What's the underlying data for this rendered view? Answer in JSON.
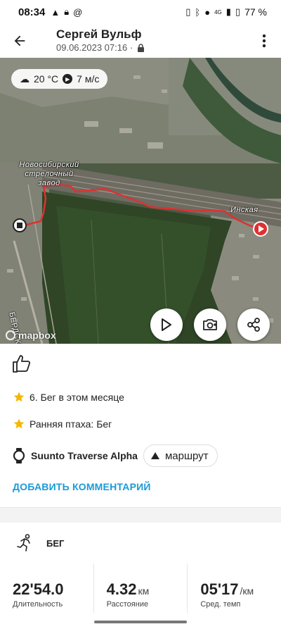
{
  "status_bar": {
    "time": "08:34",
    "battery": "77 %",
    "network": "4G"
  },
  "header": {
    "title": "Сергей Вульф",
    "subtitle": "09.06.2023 07:16 ·"
  },
  "map": {
    "weather": {
      "temp": "20 °C",
      "wind": "7 м/с"
    },
    "label_start": "Новосибирский стрелочный завод",
    "label_end": "Инская",
    "label_road": "БЕРДСКОЕ",
    "attribution": "mapbox"
  },
  "achievements": [
    {
      "text": "6. Бег в этом месяце"
    },
    {
      "text": "Ранняя птаха: Бег"
    }
  ],
  "device": {
    "name": "Suunto Traverse Alpha",
    "route_label": "маршрут"
  },
  "comment": {
    "label": "ДОБАВИТЬ КОММЕНТАРИЙ"
  },
  "sport": {
    "label": "БЕГ"
  },
  "stats": [
    {
      "value": "22'54.0",
      "unit": "",
      "label": "Длительность"
    },
    {
      "value": "4.32",
      "unit": "км",
      "label": "Расстояние"
    },
    {
      "value": "05'17",
      "unit": "/км",
      "label": "Сред. темп"
    }
  ],
  "colors": {
    "accent": "#1a9ad6",
    "route": "#e03030",
    "star": "#f5b800"
  },
  "icons": {
    "back": "arrow-left-icon",
    "more": "more-vertical-icon",
    "play": "play-icon",
    "camera": "camera-add-icon",
    "share": "share-icon",
    "like": "thumbs-up-icon",
    "star": "star-icon",
    "watch": "watch-icon",
    "route": "triangle-up-icon",
    "run": "running-icon"
  }
}
